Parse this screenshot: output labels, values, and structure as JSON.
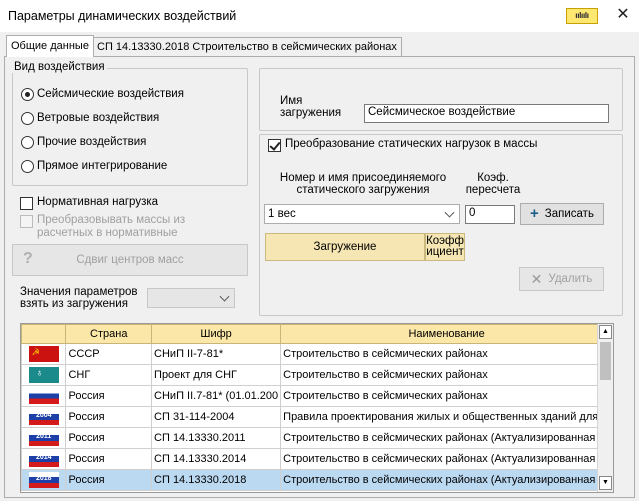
{
  "window": {
    "title": "Параметры динамических воздействий",
    "logo_text": "ıılıılı"
  },
  "tabs": [
    {
      "label": "Общие данные",
      "active": true
    },
    {
      "label": "СП 14.13330.2018 Строительство в сейсмических районах",
      "active": false
    }
  ],
  "influence_type": {
    "legend": "Вид воздействия",
    "options": [
      {
        "label": "Сейсмические воздействия",
        "checked": true
      },
      {
        "label": "Ветровые воздействия",
        "checked": false
      },
      {
        "label": "Прочие воздействия",
        "checked": false
      },
      {
        "label": "Прямое интегрирование",
        "checked": false
      }
    ]
  },
  "normative_load": {
    "label": "Нормативная нагрузка",
    "checked": false
  },
  "convert_masses": {
    "label": "Преобразовывать массы из расчетных в нормативные",
    "checked": false,
    "disabled": true
  },
  "shift_mass_centers": {
    "label": "Сдвиг центров масс",
    "icon": "question-icon"
  },
  "param_values": {
    "label": "Значения параметров взять из загружения",
    "value": ""
  },
  "load_name": {
    "label": "Имя загружения",
    "value": "Сейсмическое воздействие"
  },
  "static_to_mass": {
    "label": "Преобразование статических нагрузок в массы",
    "checked": true,
    "col1_label": "Номер и имя присоединяемого статического загружения",
    "col2_label": "Коэф. пересчета",
    "load_select": "1 вес",
    "coef": "0",
    "record_button": "Записать",
    "grid_col1": "Загружение",
    "grid_col2": "Коэфф ициент",
    "delete_button": "Удалить"
  },
  "norms_table": {
    "headers": [
      "",
      "Страна",
      "Шифр",
      "Наименование"
    ],
    "rows": [
      {
        "flag": "ussr",
        "flag_text": "",
        "country": "СССР",
        "code": "СНиП II-7-81*",
        "name": "Строительство в сейсмических районах",
        "selected": false
      },
      {
        "flag": "cis",
        "flag_text": "",
        "country": "СНГ",
        "code": "Проект для СНГ",
        "name": "Строительство в сейсмических районах",
        "selected": false
      },
      {
        "flag": "ru",
        "flag_text": "",
        "country": "Россия",
        "code": "СНиП II.7-81* (01.01.200",
        "name": "Строительство в сейсмических районах",
        "selected": false
      },
      {
        "flag": "ru-year",
        "flag_text": "2004",
        "country": "Россия",
        "code": "СП 31-114-2004",
        "name": "Правила проектирования жилых и общественных зданий для с",
        "selected": false
      },
      {
        "flag": "ru-year",
        "flag_text": "2011",
        "country": "Россия",
        "code": "СП 14.13330.2011",
        "name": "Строительство в сейсмических районах (Актуализированная р",
        "selected": false
      },
      {
        "flag": "ru-year",
        "flag_text": "2014",
        "country": "Россия",
        "code": "СП 14.13330.2014",
        "name": "Строительство в сейсмических районах (Актуализированная р",
        "selected": false
      },
      {
        "flag": "ru-year",
        "flag_text": "2018",
        "country": "Россия",
        "code": "СП 14.13330.2018",
        "name": "Строительство в сейсмических районах (Актуализированная р",
        "selected": true
      }
    ]
  },
  "colors": {
    "header_bg": "#fbe7a8",
    "selected_row": "#bcd9f2",
    "grid_header_bg": "#f5e6b3"
  }
}
